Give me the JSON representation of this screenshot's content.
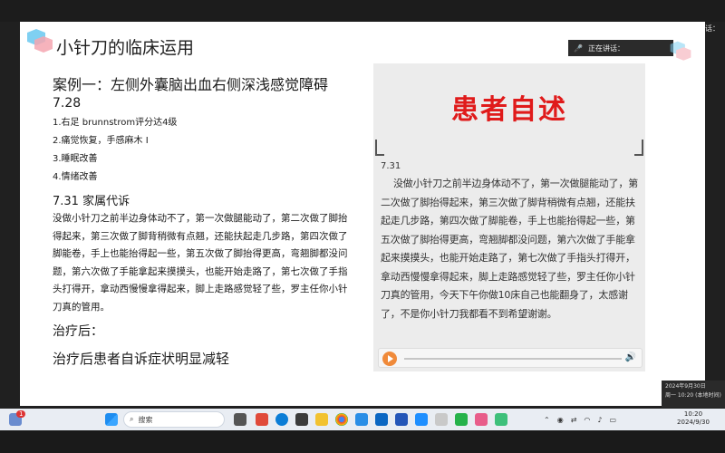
{
  "overlay": {
    "speaking_top": "正在讲话：",
    "speaking_chip": "正在讲话："
  },
  "slide": {
    "title": "小针刀的临床运用",
    "case_title": "案例一：左侧外囊脑出血右侧深浅感觉障碍",
    "case_date": "7.28",
    "items": [
      "1.右足 brunnstrom评分达4级",
      "2.痛觉恢复，手感麻木 I",
      "3.睡眠改善",
      "4.情绪改善"
    ],
    "family_heading": "7.31 家属代诉",
    "family_text": "没做小针刀之前半边身体动不了，第一次做腿能动了，第二次做了脚抬得起来，第三次做了脚背稍微有点翘，还能扶起走几步路，第四次做了脚能卷，手上也能抬得起一些，第五次做了脚抬得更高，弯翘脚都没问题，第六次做了手能拿起来摸摸头，也能开始走路了，第七次做了手指头打得开，拿动西慢慢拿得起来，脚上走路感觉轻了些，罗主任你小针刀真的管用。",
    "after_label": "治疗后：",
    "after_text": "治疗后患者自诉症状明显减轻"
  },
  "panel": {
    "title": "患者自述",
    "date": "7.31",
    "text": "没做小针刀之前半边身体动不了，第一次做腿能动了，第二次做了脚抬得起来，第三次做了脚背稍微有点翘，还能扶起走几步路，第四次做了脚能卷，手上也能抬得起一些，第五次做了脚抬得更高，弯翘脚都没问题，第六次做了手能拿起来摸摸头，也能开始走路了，第七次做了手指头打得开，拿动西慢慢拿得起来，脚上走路感觉轻了些，罗主任你小针刀真的管用，今天下午你做10床自己也能翻身了，太感谢了，不是你小针刀我都看不到希望谢谢。"
  },
  "datebox": {
    "line1": "2024年9月30日",
    "line2": "周一 10:20 (本地时间)"
  },
  "taskbar": {
    "search_placeholder": "搜索",
    "clock_time": "10:20",
    "clock_date": "2024/9/30",
    "notification_badge": "1"
  },
  "colors": {
    "panel_title": "#e01b1b",
    "play_button": "#f08a3a"
  }
}
